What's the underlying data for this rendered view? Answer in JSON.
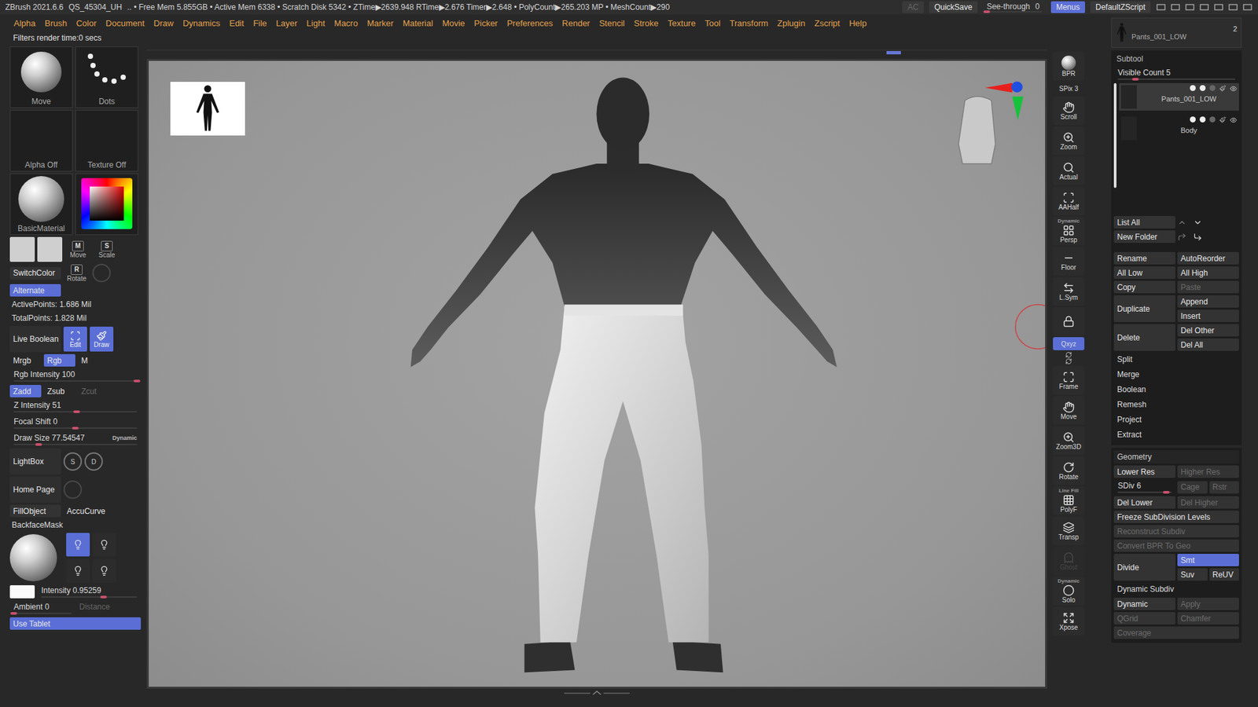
{
  "title_bar": {
    "app": "ZBrush 2021.6.6",
    "file": "QS_45304_UH",
    "stats": ".. • Free Mem 5.855GB • Active Mem 6338 • Scratch Disk 5342 •  ZTime▶2639.948 RTime▶2.676 Timer▶2.648 • PolyCount▶265.203 MP • MeshCount▶290",
    "right": [
      {
        "label": "AC",
        "kind": "dim",
        "selected": false
      },
      {
        "label": "QuickSave",
        "kind": "button",
        "selected": false
      },
      {
        "label": "See-through",
        "kind": "slider",
        "value": "0",
        "level": 0,
        "selected": false
      },
      {
        "label": "Menus",
        "kind": "button",
        "selected": true
      },
      {
        "label": "DefaultZScript",
        "kind": "button",
        "selected": false
      }
    ]
  },
  "menus": [
    "Alpha",
    "Brush",
    "Color",
    "Document",
    "Draw",
    "Dynamics",
    "Edit",
    "File",
    "Layer",
    "Light",
    "Macro",
    "Marker",
    "Material",
    "Movie",
    "Picker",
    "Preferences",
    "Render",
    "Stencil",
    "Stroke",
    "Texture",
    "Tool",
    "Transform",
    "Zplugin",
    "Zscript",
    "Help"
  ],
  "notice": "Filters render time:0 secs",
  "left_shelf": {
    "brush": "Move",
    "stroke": "Dots",
    "alpha": "Alpha Off",
    "texture": "Texture Off",
    "material": "BasicMaterial",
    "tool_buttons": [
      {
        "key": "M",
        "label": "Move"
      },
      {
        "key": "S",
        "label": "Scale"
      },
      {
        "key": "R",
        "label": "Rotate"
      }
    ],
    "switch_color": "SwitchColor",
    "alternate": {
      "label": "Alternate",
      "selected": true
    },
    "active_points": "ActivePoints: 1.686 Mil",
    "total_points": "TotalPoints: 1.828 Mil",
    "live_boolean": {
      "label": "Live Boolean",
      "selected": false
    },
    "modes": [
      {
        "label": "Edit",
        "selected": true
      },
      {
        "label": "Draw",
        "selected": true
      }
    ],
    "color_modes": [
      {
        "label": "Mrgb",
        "selected": false
      },
      {
        "label": "Rgb",
        "selected": true
      },
      {
        "label": "M",
        "selected": false
      }
    ],
    "rgb_intensity": {
      "label": "Rgb Intensity",
      "value": "100",
      "level": 1
    },
    "depth_modes": [
      {
        "label": "Zadd",
        "selected": true,
        "disabled": false
      },
      {
        "label": "Zsub",
        "selected": false,
        "disabled": false
      },
      {
        "label": "Zcut",
        "selected": false,
        "disabled": true
      }
    ],
    "sliders": [
      {
        "label": "Z Intensity",
        "value": "51",
        "level": 0.51
      },
      {
        "label": "Focal Shift",
        "value": "0",
        "level": 0.5
      },
      {
        "label": "Draw Size",
        "value": "77.54547",
        "level": 0.2,
        "badge": "Dynamic"
      }
    ],
    "lightbox": "LightBox",
    "size_icons": [
      {
        "key": "S"
      },
      {
        "key": "D"
      }
    ],
    "home_page": "Home Page",
    "fill_object": "FillObject",
    "accucurve": "AccuCurve",
    "backface_mask": "BackfaceMask",
    "lights": [
      {
        "selected": true
      },
      {
        "selected": false
      },
      {
        "selected": false
      },
      {
        "selected": false
      }
    ],
    "intensity": {
      "label": "Intensity",
      "value": "0.95259",
      "level": 0.65
    },
    "ambient": {
      "label": "Ambient",
      "value": "0",
      "level": 0
    },
    "distance": {
      "label": "Distance",
      "disabled": true
    },
    "use_tablet": {
      "label": "Use Tablet",
      "selected": true
    }
  },
  "right_shelf": [
    {
      "label": "BPR",
      "kind": "sphere",
      "selected": false,
      "disabled": false
    },
    {
      "label": "SPix 3",
      "kind": "text",
      "selected": false,
      "disabled": false
    },
    {
      "label": "Scroll",
      "kind": "button",
      "selected": false,
      "disabled": false
    },
    {
      "label": "Zoom",
      "kind": "button",
      "selected": false,
      "disabled": false
    },
    {
      "label": "Actual",
      "kind": "button",
      "selected": false,
      "disabled": false
    },
    {
      "label": "AAHalf",
      "kind": "button",
      "selected": false,
      "disabled": false
    },
    {
      "label": "Persp",
      "top": "Dynamic",
      "kind": "button",
      "selected": false,
      "disabled": false
    },
    {
      "label": "Floor",
      "kind": "button",
      "selected": false,
      "disabled": false
    },
    {
      "label": "L.Sym",
      "kind": "button",
      "selected": false,
      "disabled": false
    },
    {
      "kind": "icon",
      "selected": false,
      "disabled": false
    },
    {
      "label": "Qxyz",
      "kind": "toggle",
      "selected": true,
      "disabled": false
    },
    {
      "kind": "icons",
      "selected": false,
      "disabled": false
    },
    {
      "label": "Frame",
      "kind": "button",
      "selected": false,
      "disabled": false
    },
    {
      "label": "Move",
      "kind": "button",
      "selected": false,
      "disabled": false
    },
    {
      "label": "Zoom3D",
      "kind": "button",
      "selected": false,
      "disabled": false
    },
    {
      "label": "Rotate",
      "kind": "button",
      "selected": false,
      "disabled": false
    },
    {
      "label": "PolyF",
      "top": "Line Fill",
      "kind": "button",
      "selected": false,
      "disabled": false
    },
    {
      "label": "Transp",
      "kind": "button",
      "selected": false,
      "disabled": false
    },
    {
      "label": "Ghost",
      "kind": "button",
      "selected": false,
      "disabled": true
    },
    {
      "label": "Solo",
      "top": "Dynamic",
      "kind": "button",
      "selected": false,
      "disabled": false
    },
    {
      "label": "Xpose",
      "kind": "button",
      "selected": false,
      "disabled": false
    }
  ],
  "tray": {
    "thumb_count": "2",
    "thumb_label": "Pants_001_LOW",
    "subtool": {
      "title": "Subtool",
      "visible_count": {
        "label": "Visible Count",
        "value": "5",
        "level": 0.15
      },
      "items": [
        {
          "name": "Pants_001_LOW",
          "selected": true
        },
        {
          "name": "Body",
          "selected": false
        }
      ]
    },
    "list_all": "List All",
    "new_folder": "New Folder",
    "rows": [
      {
        "kind": "pair",
        "buttons": [
          {
            "label": "Rename",
            "selected": false,
            "disabled": false
          },
          {
            "label": "AutoReorder",
            "selected": false,
            "disabled": false
          }
        ]
      },
      {
        "kind": "pair",
        "buttons": [
          {
            "label": "All Low",
            "selected": false,
            "disabled": false
          },
          {
            "label": "All High",
            "selected": false,
            "disabled": false
          }
        ]
      },
      {
        "kind": "pair",
        "buttons": [
          {
            "label": "Copy",
            "selected": false,
            "disabled": false
          },
          {
            "label": "Paste",
            "selected": false,
            "disabled": true
          }
        ]
      },
      {
        "kind": "split",
        "buttons": [
          {
            "label": "Duplicate",
            "selected": false,
            "disabled": false
          },
          {
            "label": "Append",
            "selected": false,
            "disabled": false
          },
          {
            "label": "Insert",
            "selected": false,
            "disabled": false
          }
        ]
      },
      {
        "kind": "split",
        "buttons": [
          {
            "label": "Delete",
            "selected": false,
            "disabled": false
          },
          {
            "label": "Del Other",
            "selected": false,
            "disabled": false
          },
          {
            "label": "Del All",
            "selected": false,
            "disabled": false
          }
        ]
      },
      {
        "kind": "section",
        "label": "Split"
      },
      {
        "kind": "section",
        "label": "Merge"
      },
      {
        "kind": "section",
        "label": "Boolean"
      },
      {
        "kind": "section",
        "label": "Remesh"
      },
      {
        "kind": "section",
        "label": "Project"
      },
      {
        "kind": "section",
        "label": "Extract"
      }
    ],
    "geometry_title": "Geometry",
    "geometry": [
      {
        "kind": "pair",
        "buttons": [
          {
            "label": "Lower Res",
            "selected": false,
            "disabled": false
          },
          {
            "label": "Higher Res",
            "selected": false,
            "disabled": true
          }
        ]
      },
      {
        "kind": "slider",
        "label": "SDiv",
        "value": "6",
        "level": 0.9,
        "buttons": [
          {
            "label": "Cage",
            "selected": false,
            "disabled": true
          },
          {
            "label": "Rstr",
            "selected": false,
            "disabled": true
          }
        ]
      },
      {
        "kind": "pair",
        "buttons": [
          {
            "label": "Del Lower",
            "selected": false,
            "disabled": false
          },
          {
            "label": "Del Higher",
            "selected": false,
            "disabled": true
          }
        ]
      },
      {
        "kind": "wide",
        "buttons": [
          {
            "label": "Freeze SubDivision Levels",
            "selected": false,
            "disabled": false
          }
        ]
      },
      {
        "kind": "wide",
        "buttons": [
          {
            "label": "Reconstruct Subdiv",
            "selected": false,
            "disabled": true
          }
        ]
      },
      {
        "kind": "wide",
        "buttons": [
          {
            "label": "Convert BPR To Geo",
            "selected": false,
            "disabled": true
          }
        ]
      },
      {
        "kind": "divide",
        "buttons": [
          {
            "label": "Divide",
            "selected": false,
            "disabled": false
          },
          {
            "label": "Smt",
            "selected": true,
            "disabled": false
          },
          {
            "label": "Suv",
            "selected": false,
            "disabled": false
          },
          {
            "label": "ReUV",
            "selected": false,
            "disabled": false
          }
        ]
      },
      {
        "kind": "section",
        "label": "Dynamic Subdiv"
      },
      {
        "kind": "pair",
        "buttons": [
          {
            "label": "Dynamic",
            "selected": false,
            "disabled": false
          },
          {
            "label": "Apply",
            "selected": false,
            "disabled": true
          }
        ]
      },
      {
        "kind": "pair",
        "buttons": [
          {
            "label": "QGrid",
            "selected": false,
            "disabled": true
          },
          {
            "label": "Chamfer",
            "selected": false,
            "disabled": true
          }
        ]
      },
      {
        "kind": "wide",
        "buttons": [
          {
            "label": "Coverage",
            "selected": false,
            "disabled": true
          }
        ]
      }
    ]
  }
}
